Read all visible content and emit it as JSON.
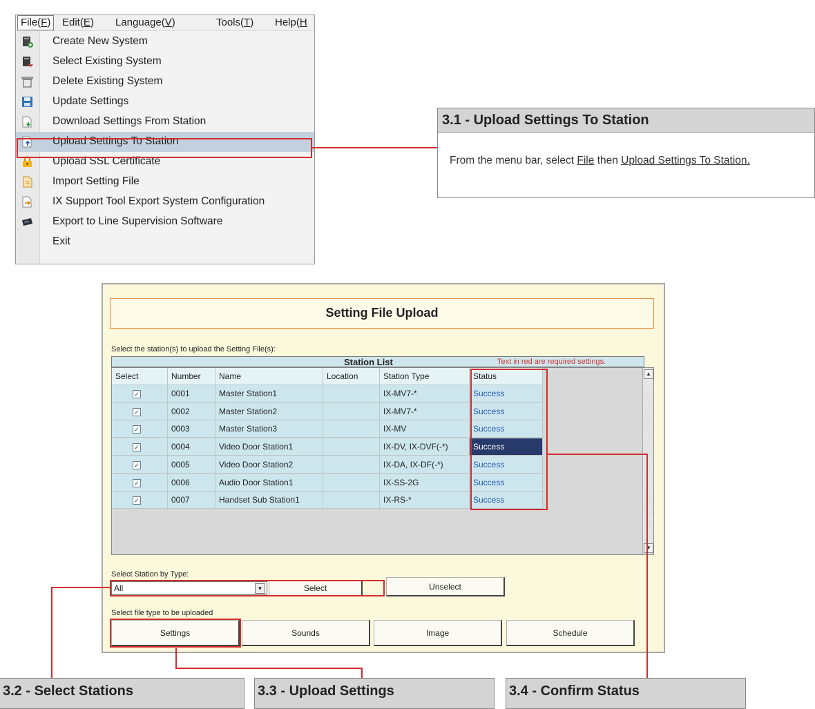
{
  "menubar": {
    "items": [
      {
        "text": "File",
        "key": "F"
      },
      {
        "text": "Edit",
        "key": "E"
      },
      {
        "text": "Language",
        "key": "V"
      },
      {
        "text": "Tools",
        "key": "T"
      },
      {
        "text": "Help",
        "key": "H"
      }
    ]
  },
  "file_menu": {
    "items": [
      {
        "label": "Create New System",
        "icon": "create-system-icon"
      },
      {
        "label": "Select Existing System",
        "icon": "select-system-icon"
      },
      {
        "label": "Delete Existing System",
        "icon": "trash-icon"
      },
      {
        "label": "Update Settings",
        "icon": "save-disk-icon"
      },
      {
        "label": "Download Settings From Station",
        "icon": "download-icon"
      },
      {
        "label": "Upload Settings To Station",
        "icon": "upload-icon",
        "highlighted": true
      },
      {
        "label": "Upload SSL Certificate",
        "icon": "lock-icon"
      },
      {
        "label": "Import Setting File",
        "icon": "import-file-icon"
      },
      {
        "label": "IX Support Tool Export System Configuration",
        "icon": "export-icon"
      },
      {
        "label": "Export to Line Supervision Software",
        "icon": "device-icon"
      },
      {
        "label": "Exit",
        "icon": ""
      }
    ]
  },
  "callout_31": {
    "title": "3.1 - Upload Settings To Station",
    "body_prefix": "From the menu bar, select ",
    "body_link1": "File",
    "body_mid": " then ",
    "body_link2": "Upload Settings To Station."
  },
  "upload_window": {
    "title": "Setting File Upload",
    "instruction": "Select the station(s) to upload the Setting File(s):",
    "station_list_title": "Station List",
    "required_note": "Text in red are required settings.",
    "columns": [
      "Select",
      "Number",
      "Name",
      "Location",
      "Station Type",
      "Status"
    ],
    "rows": [
      {
        "number": "0001",
        "name": "Master Station1",
        "location": "",
        "type": "IX-MV7-*",
        "status": "Success"
      },
      {
        "number": "0002",
        "name": "Master Station2",
        "location": "",
        "type": "IX-MV7-*",
        "status": "Success"
      },
      {
        "number": "0003",
        "name": "Master Station3",
        "location": "",
        "type": "IX-MV",
        "status": "Success"
      },
      {
        "number": "0004",
        "name": "Video Door Station1",
        "location": "",
        "type": "IX-DV, IX-DVF(-*)",
        "status": "Success",
        "selected": true
      },
      {
        "number": "0005",
        "name": "Video Door Station2",
        "location": "",
        "type": "IX-DA, IX-DF(-*)",
        "status": "Success"
      },
      {
        "number": "0006",
        "name": "Audio Door Station1",
        "location": "",
        "type": "IX-SS-2G",
        "status": "Success"
      },
      {
        "number": "0007",
        "name": "Handset Sub Station1",
        "location": "",
        "type": "IX-RS-*",
        "status": "Success"
      }
    ],
    "select_by_type_label": "Select Station by Type:",
    "type_dropdown_value": "All",
    "select_button": "Select",
    "unselect_button": "Unselect",
    "file_type_label": "Select file type to be uploaded",
    "file_type_buttons": [
      "Settings",
      "Sounds",
      "Image",
      "Schedule"
    ]
  },
  "bottom_callouts": [
    "3.2 - Select Stations",
    "3.3 - Upload Settings",
    "3.4 - Confirm Status"
  ],
  "colors": {
    "highlight_red": "#d32b2b",
    "window_bg": "#fbf8dc",
    "table_row": "#cde6ee",
    "status_blue": "#2459b4",
    "selected_status": "#283a6a",
    "title_border": "#e58d3c"
  }
}
